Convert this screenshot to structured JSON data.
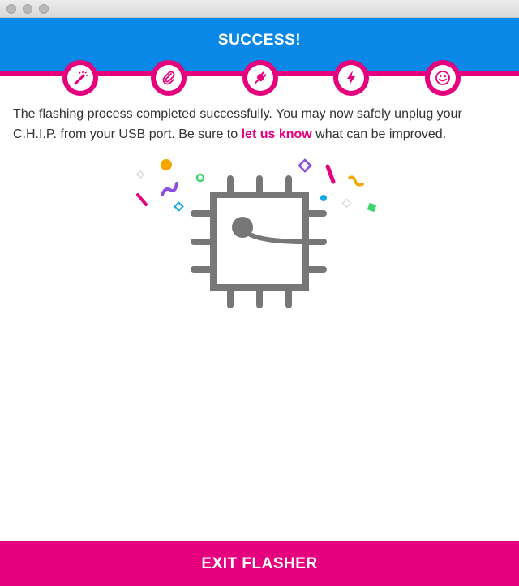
{
  "window": {
    "controls": [
      "close",
      "minimize",
      "zoom"
    ]
  },
  "header": {
    "title": "SUCCESS!",
    "background": "#0a88e8",
    "accent": "#e5007e"
  },
  "steps": [
    {
      "icon": "magic-wand-icon"
    },
    {
      "icon": "paperclip-icon"
    },
    {
      "icon": "plug-icon"
    },
    {
      "icon": "lightning-icon"
    },
    {
      "icon": "smiley-icon"
    }
  ],
  "message": {
    "part1": "The flashing process completed successfully. You may now safely unplug your C.H.I.P. from your USB port.  Be sure to ",
    "link": "let us know",
    "part2": " what can be improved."
  },
  "exit_button": {
    "label": "EXIT FLASHER"
  }
}
